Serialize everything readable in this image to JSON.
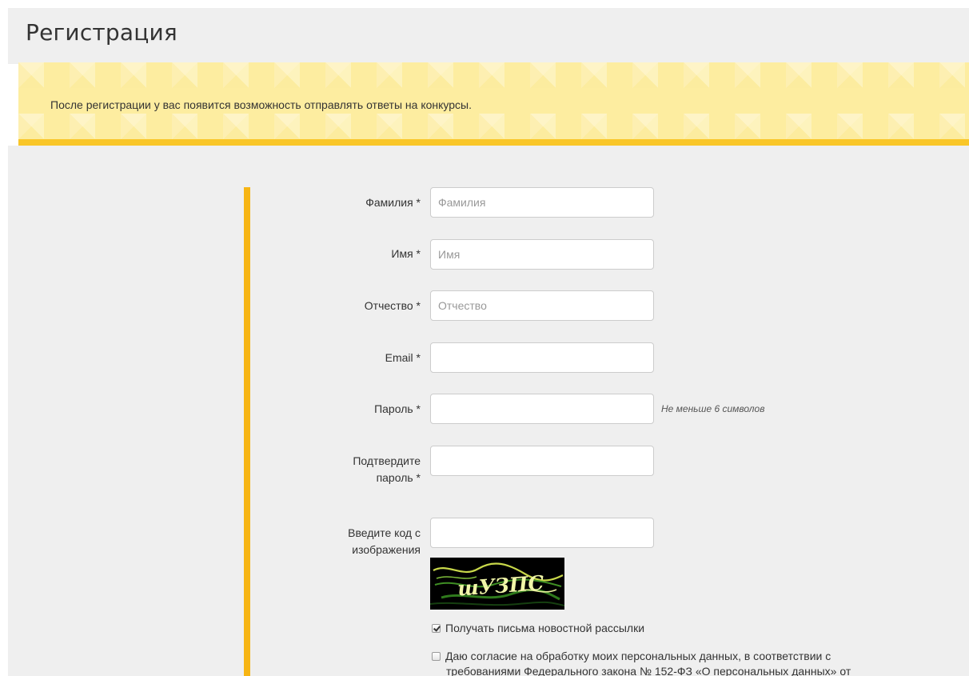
{
  "page": {
    "title": "Регистрация"
  },
  "banner": {
    "text": "После регистрации у вас появится возможность отправлять ответы на конкурсы."
  },
  "form": {
    "last_name": {
      "label": "Фамилия *",
      "value": "",
      "placeholder": "Фамилия"
    },
    "first_name": {
      "label": "Имя *",
      "value": "",
      "placeholder": "Имя"
    },
    "patronymic": {
      "label": "Отчество *",
      "value": "",
      "placeholder": "Отчество"
    },
    "email": {
      "label": "Email *",
      "value": "",
      "placeholder": ""
    },
    "password": {
      "label": "Пароль *",
      "value": "",
      "placeholder": "",
      "hint": "Не меньше 6 символов"
    },
    "password_confirm": {
      "label_line1": "Подтвердите",
      "label_line2": "пароль *",
      "value": "",
      "placeholder": ""
    },
    "captcha": {
      "label_line1": "Введите код с",
      "label_line2": "изображения",
      "value": "",
      "placeholder": "",
      "image_text": "шУЗПС"
    },
    "newsletter": {
      "label": "Получать письма новостной рассылки",
      "checked": true
    },
    "consent": {
      "line1": "Даю согласие на обработку моих персональных данных, в соответствии с",
      "line2": "требованиями Федерального закона № 152-ФЗ «О персональных данных» от",
      "checked": false
    }
  },
  "colors": {
    "banner_bg": "#fdeda0",
    "banner_stripe": "#f9c628",
    "accent_line": "#f7b514",
    "panel_bg": "#efefef"
  }
}
